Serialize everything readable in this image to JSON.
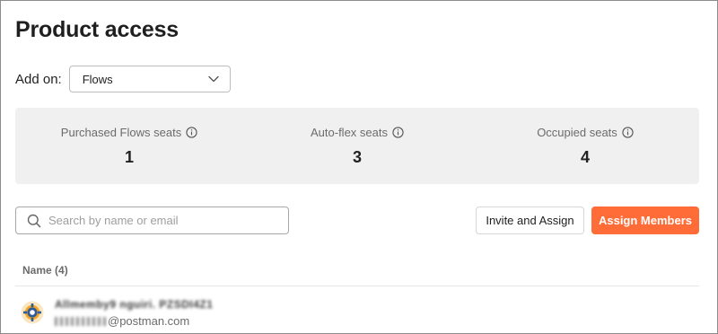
{
  "page": {
    "title": "Product access"
  },
  "addon": {
    "label": "Add on:",
    "selected": "Flows"
  },
  "stats": [
    {
      "label": "Purchased Flows seats",
      "value": "1",
      "icon": "info-icon"
    },
    {
      "label": "Auto-flex seats",
      "value": "3",
      "icon": "info-icon"
    },
    {
      "label": "Occupied seats",
      "value": "4",
      "icon": "info-icon"
    }
  ],
  "search": {
    "placeholder": "Search by name or email",
    "value": ""
  },
  "actions": {
    "invite_label": "Invite and Assign",
    "assign_label": "Assign Members"
  },
  "table": {
    "column_name": "Name (4)",
    "rows": [
      {
        "name": "Allmemby9 nguiri. PZSDI4Z1",
        "email_domain": "@postman.com",
        "avatar_icon": "user-avatar-icon"
      }
    ]
  },
  "colors": {
    "accent": "#ff6c37",
    "stats_bg": "#f0f0f0"
  }
}
